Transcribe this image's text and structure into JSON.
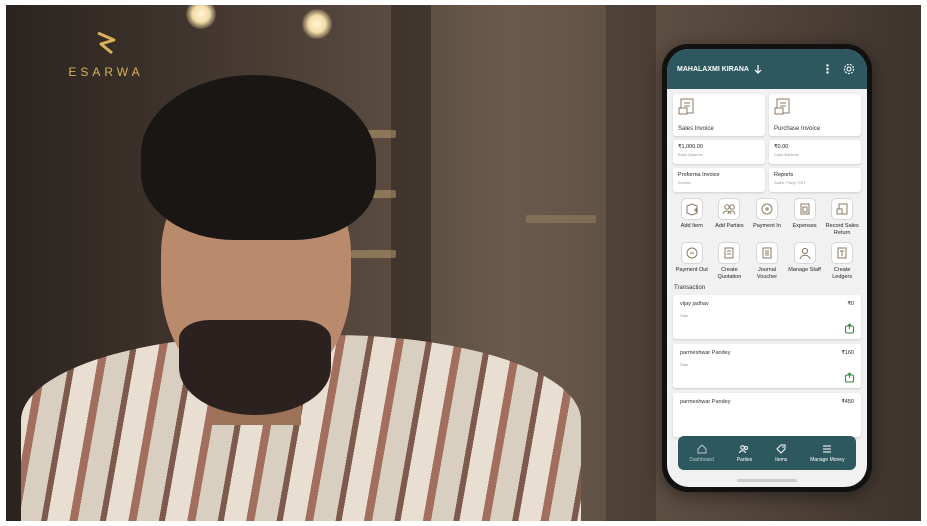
{
  "logo": {
    "text": "ESARWA"
  },
  "app": {
    "business_name": "MAHALAXMI KIRANA",
    "colors": {
      "header": "#2d5860",
      "accent": "#3a8d3f"
    }
  },
  "tiles": [
    {
      "label": "Sales Invoice",
      "icon": "sales-invoice-icon"
    },
    {
      "label": "Purchase Invoice",
      "icon": "purchase-invoice-icon"
    }
  ],
  "balances": [
    {
      "value": "₹1,000.00",
      "sub": "Bank Balance"
    },
    {
      "value": "₹0.00",
      "sub": "Cash Balance"
    }
  ],
  "shortcuts": [
    {
      "value": "Proforma Invoice",
      "sub": "Invoice"
    },
    {
      "value": "Reports",
      "sub": "Sales, Party, GST.."
    }
  ],
  "actions": [
    {
      "label": "Add Item",
      "icon": "add-item-icon"
    },
    {
      "label": "Add Parties",
      "icon": "add-parties-icon"
    },
    {
      "label": "Payment In",
      "icon": "payment-in-icon"
    },
    {
      "label": "Expenses",
      "icon": "expenses-icon"
    },
    {
      "label": "Record Sales Return",
      "icon": "sales-return-icon"
    },
    {
      "label": "Payment Out",
      "icon": "payment-out-icon"
    },
    {
      "label": "Create Quotation",
      "icon": "quotation-icon"
    },
    {
      "label": "Journal Voucher",
      "icon": "journal-voucher-icon"
    },
    {
      "label": "Manage Staff",
      "icon": "manage-staff-icon"
    },
    {
      "label": "Create Ledgers",
      "icon": "ledger-icon"
    }
  ],
  "transactions_title": "Transaction",
  "transactions": [
    {
      "name": "vijay jadhav",
      "amount": "₹0",
      "type": "Sale"
    },
    {
      "name": "parmeshwar Pandey",
      "amount": "₹160",
      "type": "Sale"
    },
    {
      "name": "parmeshwar Pandey",
      "amount": "₹450",
      "type": ""
    }
  ],
  "nav": [
    {
      "label": "Dashboard",
      "icon": "home-icon"
    },
    {
      "label": "Parties",
      "icon": "parties-icon"
    },
    {
      "label": "Items",
      "icon": "tag-icon"
    },
    {
      "label": "Manage Money",
      "icon": "list-icon"
    }
  ]
}
